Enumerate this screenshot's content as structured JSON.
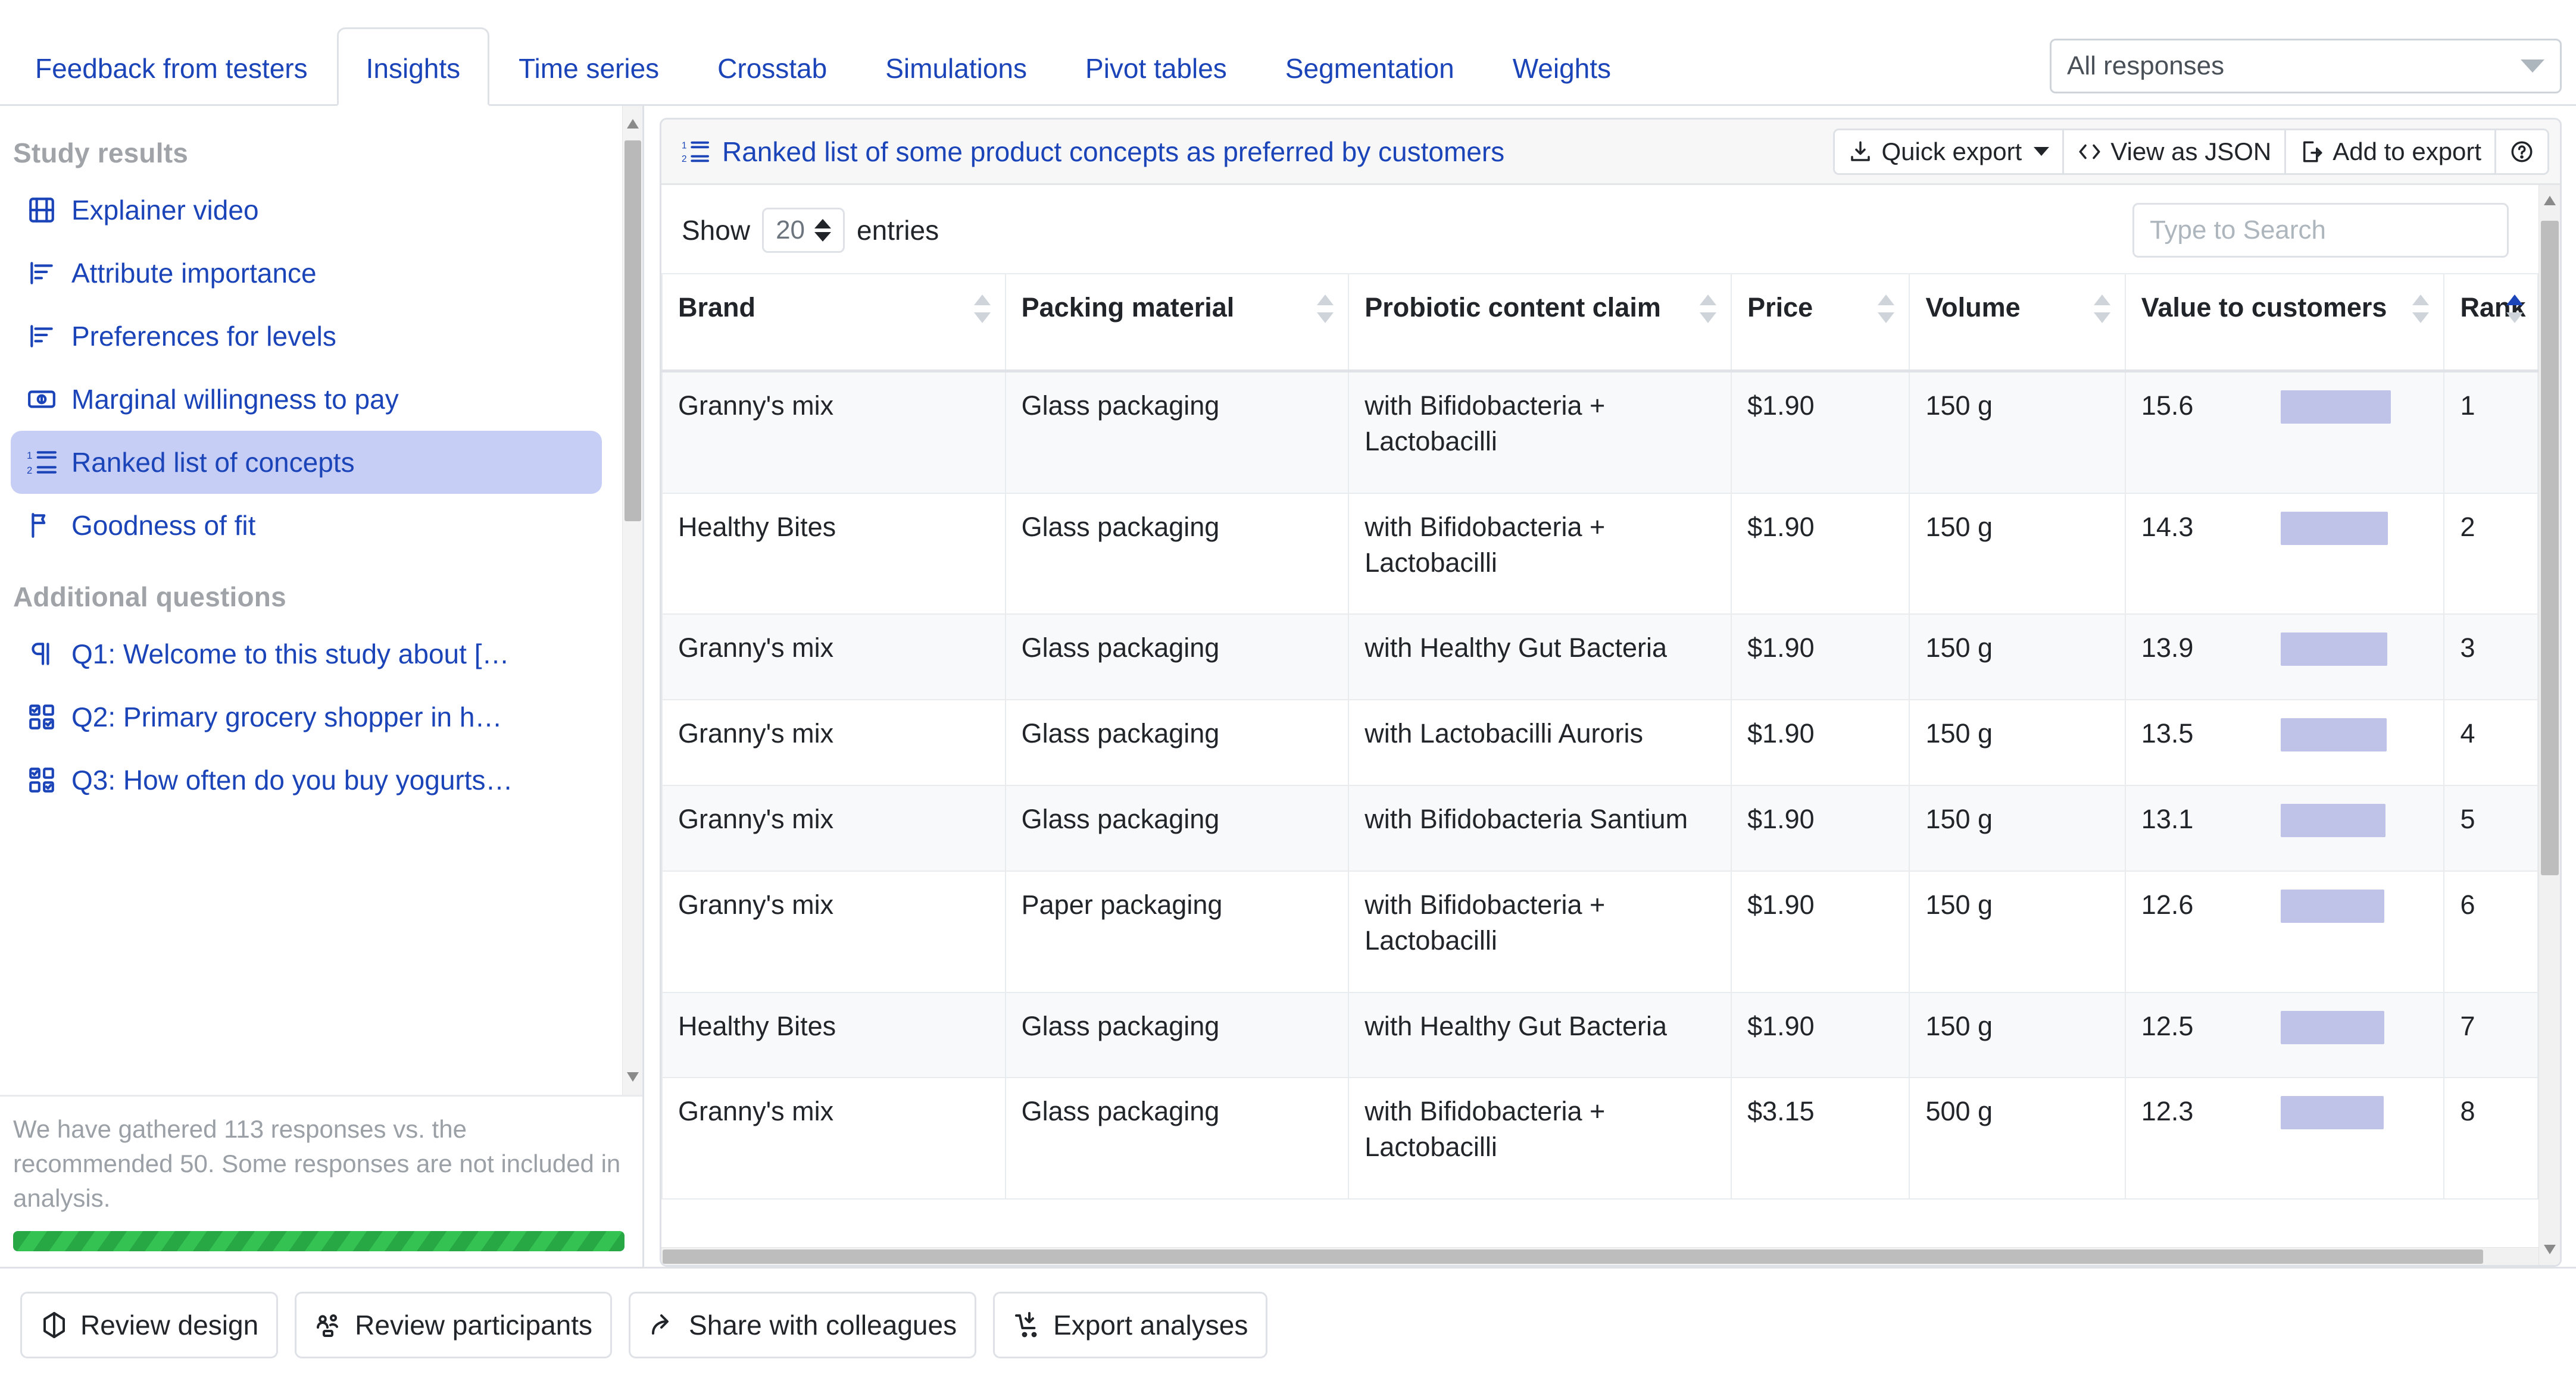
{
  "tabs": [
    {
      "label": "Feedback from testers",
      "active": false
    },
    {
      "label": "Insights",
      "active": true
    },
    {
      "label": "Time series",
      "active": false
    },
    {
      "label": "Crosstab",
      "active": false
    },
    {
      "label": "Simulations",
      "active": false
    },
    {
      "label": "Pivot tables",
      "active": false
    },
    {
      "label": "Segmentation",
      "active": false
    },
    {
      "label": "Weights",
      "active": false
    }
  ],
  "response_filter": {
    "value": "All responses",
    "icon": "chevron-down-icon"
  },
  "sidebar": {
    "study_results_heading": "Study results",
    "study_results_items": [
      {
        "label": "Explainer video",
        "icon": "film-icon",
        "selected": false
      },
      {
        "label": "Attribute importance",
        "icon": "bar-chart-icon",
        "selected": false
      },
      {
        "label": "Preferences for levels",
        "icon": "bar-chart-icon",
        "selected": false
      },
      {
        "label": "Marginal willingness to pay",
        "icon": "money-icon",
        "selected": false
      },
      {
        "label": "Ranked list of concepts",
        "icon": "ordered-list-icon",
        "selected": true
      },
      {
        "label": "Goodness of fit",
        "icon": "flag-icon",
        "selected": false
      }
    ],
    "additional_questions_heading": "Additional questions",
    "additional_questions_items": [
      {
        "label": "Q1: Welcome to this study about […",
        "icon": "paragraph-icon"
      },
      {
        "label": "Q2: Primary grocery shopper in h…",
        "icon": "checkbox-grid-icon"
      },
      {
        "label": "Q3: How often do you buy yogurts…",
        "icon": "checkbox-grid-icon"
      }
    ],
    "footer_note": "We have gathered 113 responses vs. the recommended 50. Some responses are not included in analysis.",
    "progress_color": "#28a745"
  },
  "card": {
    "title": "Ranked list of some product concepts as preferred by customers",
    "title_icon": "ordered-list-icon",
    "actions": [
      {
        "label": "Quick export",
        "icon": "download-icon",
        "has_caret": true
      },
      {
        "label": "View as JSON",
        "icon": "code-icon",
        "has_caret": false
      },
      {
        "label": "Add to export",
        "icon": "file-export-icon",
        "has_caret": false
      },
      {
        "label": "",
        "icon": "help-circle-icon",
        "has_caret": false
      }
    ]
  },
  "table_controls": {
    "show_label": "Show",
    "entries_value": "20",
    "entries_label": "entries",
    "search_placeholder": "Type to Search"
  },
  "chart_data": {
    "type": "table",
    "title": "Ranked list of some product concepts as preferred by customers",
    "columns": [
      "Brand",
      "Packing material",
      "Probiotic content claim",
      "Price",
      "Volume",
      "Value to customers",
      "Rank"
    ],
    "sorted_by": "Rank",
    "sort_direction": "asc",
    "bar_column": "Value to customers",
    "bar_color": "#bfc3e8",
    "bar_max": 15.6,
    "rows": [
      {
        "brand": "Granny's mix",
        "packing": "Glass packaging",
        "claim": "with Bifidobacteria + Lactobacilli",
        "price": "$1.90",
        "volume": "150 g",
        "value": 15.6,
        "rank": "1"
      },
      {
        "brand": "Healthy Bites",
        "packing": "Glass packaging",
        "claim": "with Bifidobacteria + Lactobacilli",
        "price": "$1.90",
        "volume": "150 g",
        "value": 14.3,
        "rank": "2"
      },
      {
        "brand": "Granny's mix",
        "packing": "Glass packaging",
        "claim": "with Healthy Gut Bacteria",
        "price": "$1.90",
        "volume": "150 g",
        "value": 13.9,
        "rank": "3"
      },
      {
        "brand": "Granny's mix",
        "packing": "Glass packaging",
        "claim": "with Lactobacilli Auroris",
        "price": "$1.90",
        "volume": "150 g",
        "value": 13.5,
        "rank": "4"
      },
      {
        "brand": "Granny's mix",
        "packing": "Glass packaging",
        "claim": "with Bifidobacteria Santium",
        "price": "$1.90",
        "volume": "150 g",
        "value": 13.1,
        "rank": "5"
      },
      {
        "brand": "Granny's mix",
        "packing": "Paper packaging",
        "claim": "with Bifidobacteria + Lactobacilli",
        "price": "$1.90",
        "volume": "150 g",
        "value": 12.6,
        "rank": "6"
      },
      {
        "brand": "Healthy Bites",
        "packing": "Glass packaging",
        "claim": "with Healthy Gut Bacteria",
        "price": "$1.90",
        "volume": "150 g",
        "value": 12.5,
        "rank": "7"
      },
      {
        "brand": "Granny's mix",
        "packing": "Glass packaging",
        "claim": "with Bifidobacteria + Lactobacilli",
        "price": "$3.15",
        "volume": "500 g",
        "value": 12.3,
        "rank": "8"
      }
    ]
  },
  "footer_buttons": [
    {
      "label": "Review design",
      "icon": "cube-icon"
    },
    {
      "label": "Review participants",
      "icon": "people-icon"
    },
    {
      "label": "Share with colleagues",
      "icon": "share-icon"
    },
    {
      "label": "Export analyses",
      "icon": "cart-download-icon"
    }
  ]
}
